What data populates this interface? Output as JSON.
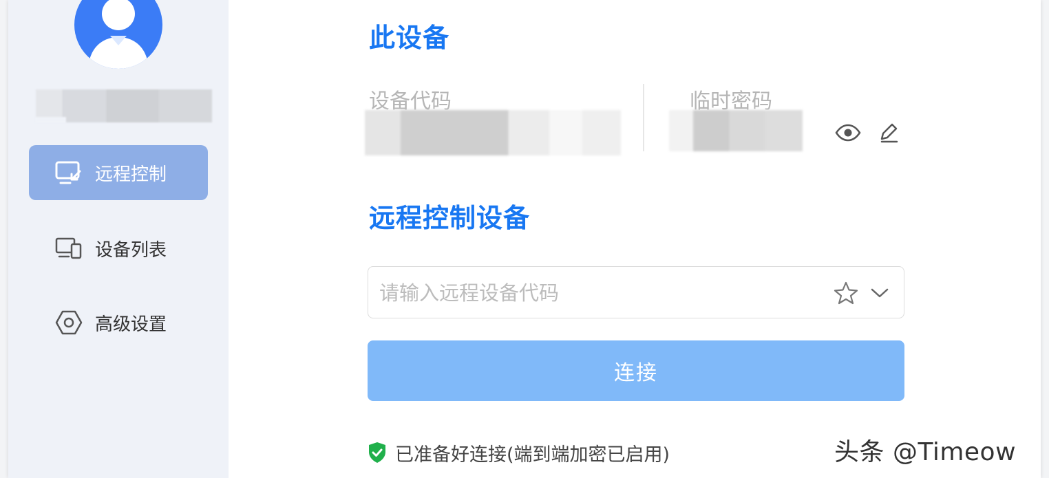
{
  "sidebar": {
    "nav": [
      {
        "label": "远程控制",
        "icon": "remote-control-icon",
        "active": true
      },
      {
        "label": "设备列表",
        "icon": "device-list-icon",
        "active": false
      },
      {
        "label": "高级设置",
        "icon": "settings-hexagon-icon",
        "active": false
      }
    ]
  },
  "this_device": {
    "title": "此设备",
    "device_code_label": "设备代码",
    "temp_password_label": "临时密码"
  },
  "remote": {
    "title": "远程控制设备",
    "input_placeholder": "请输入远程设备代码",
    "connect_label": "连接"
  },
  "status": {
    "text": "已准备好连接(端到端加密已启用)"
  },
  "watermark": "头条 @Timeow",
  "colors": {
    "accent": "#1877f2",
    "nav_active_bg": "#8eaee6",
    "connect_button": "#80b9f9",
    "status_ok": "#20b04b",
    "avatar": "#3b7cf6"
  }
}
